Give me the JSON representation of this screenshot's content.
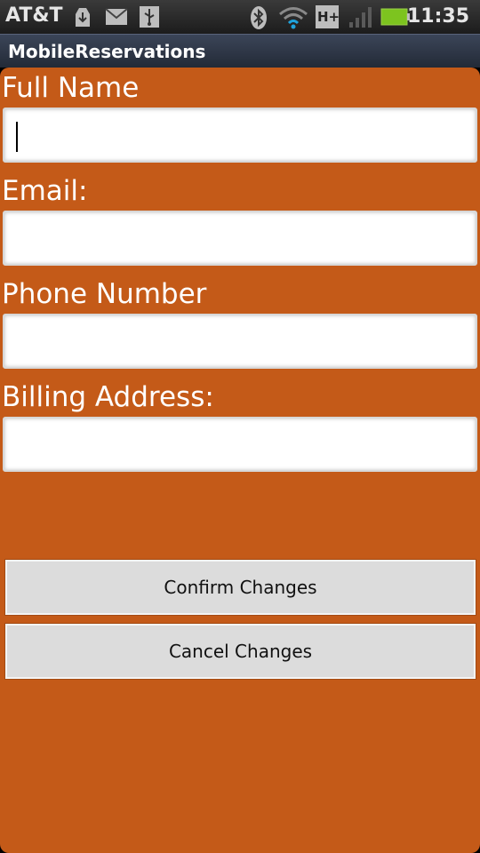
{
  "status_bar": {
    "carrier": "AT&T",
    "time": "11:35",
    "network_badge": "H+",
    "icons": [
      "download-icon",
      "mail-icon",
      "usb-icon",
      "bluetooth-icon",
      "wifi-icon",
      "network-type-icon",
      "signal-icon",
      "battery-icon"
    ]
  },
  "app": {
    "title": "MobileReservations"
  },
  "form": {
    "fields": [
      {
        "label": "Full Name",
        "value": ""
      },
      {
        "label": "Email:",
        "value": ""
      },
      {
        "label": "Phone Number",
        "value": ""
      },
      {
        "label": "Billing Address:",
        "value": ""
      }
    ],
    "confirm_label": "Confirm Changes",
    "cancel_label": "Cancel Changes"
  },
  "colors": {
    "panel": "#c45a18",
    "button": "#dcdcdc"
  }
}
